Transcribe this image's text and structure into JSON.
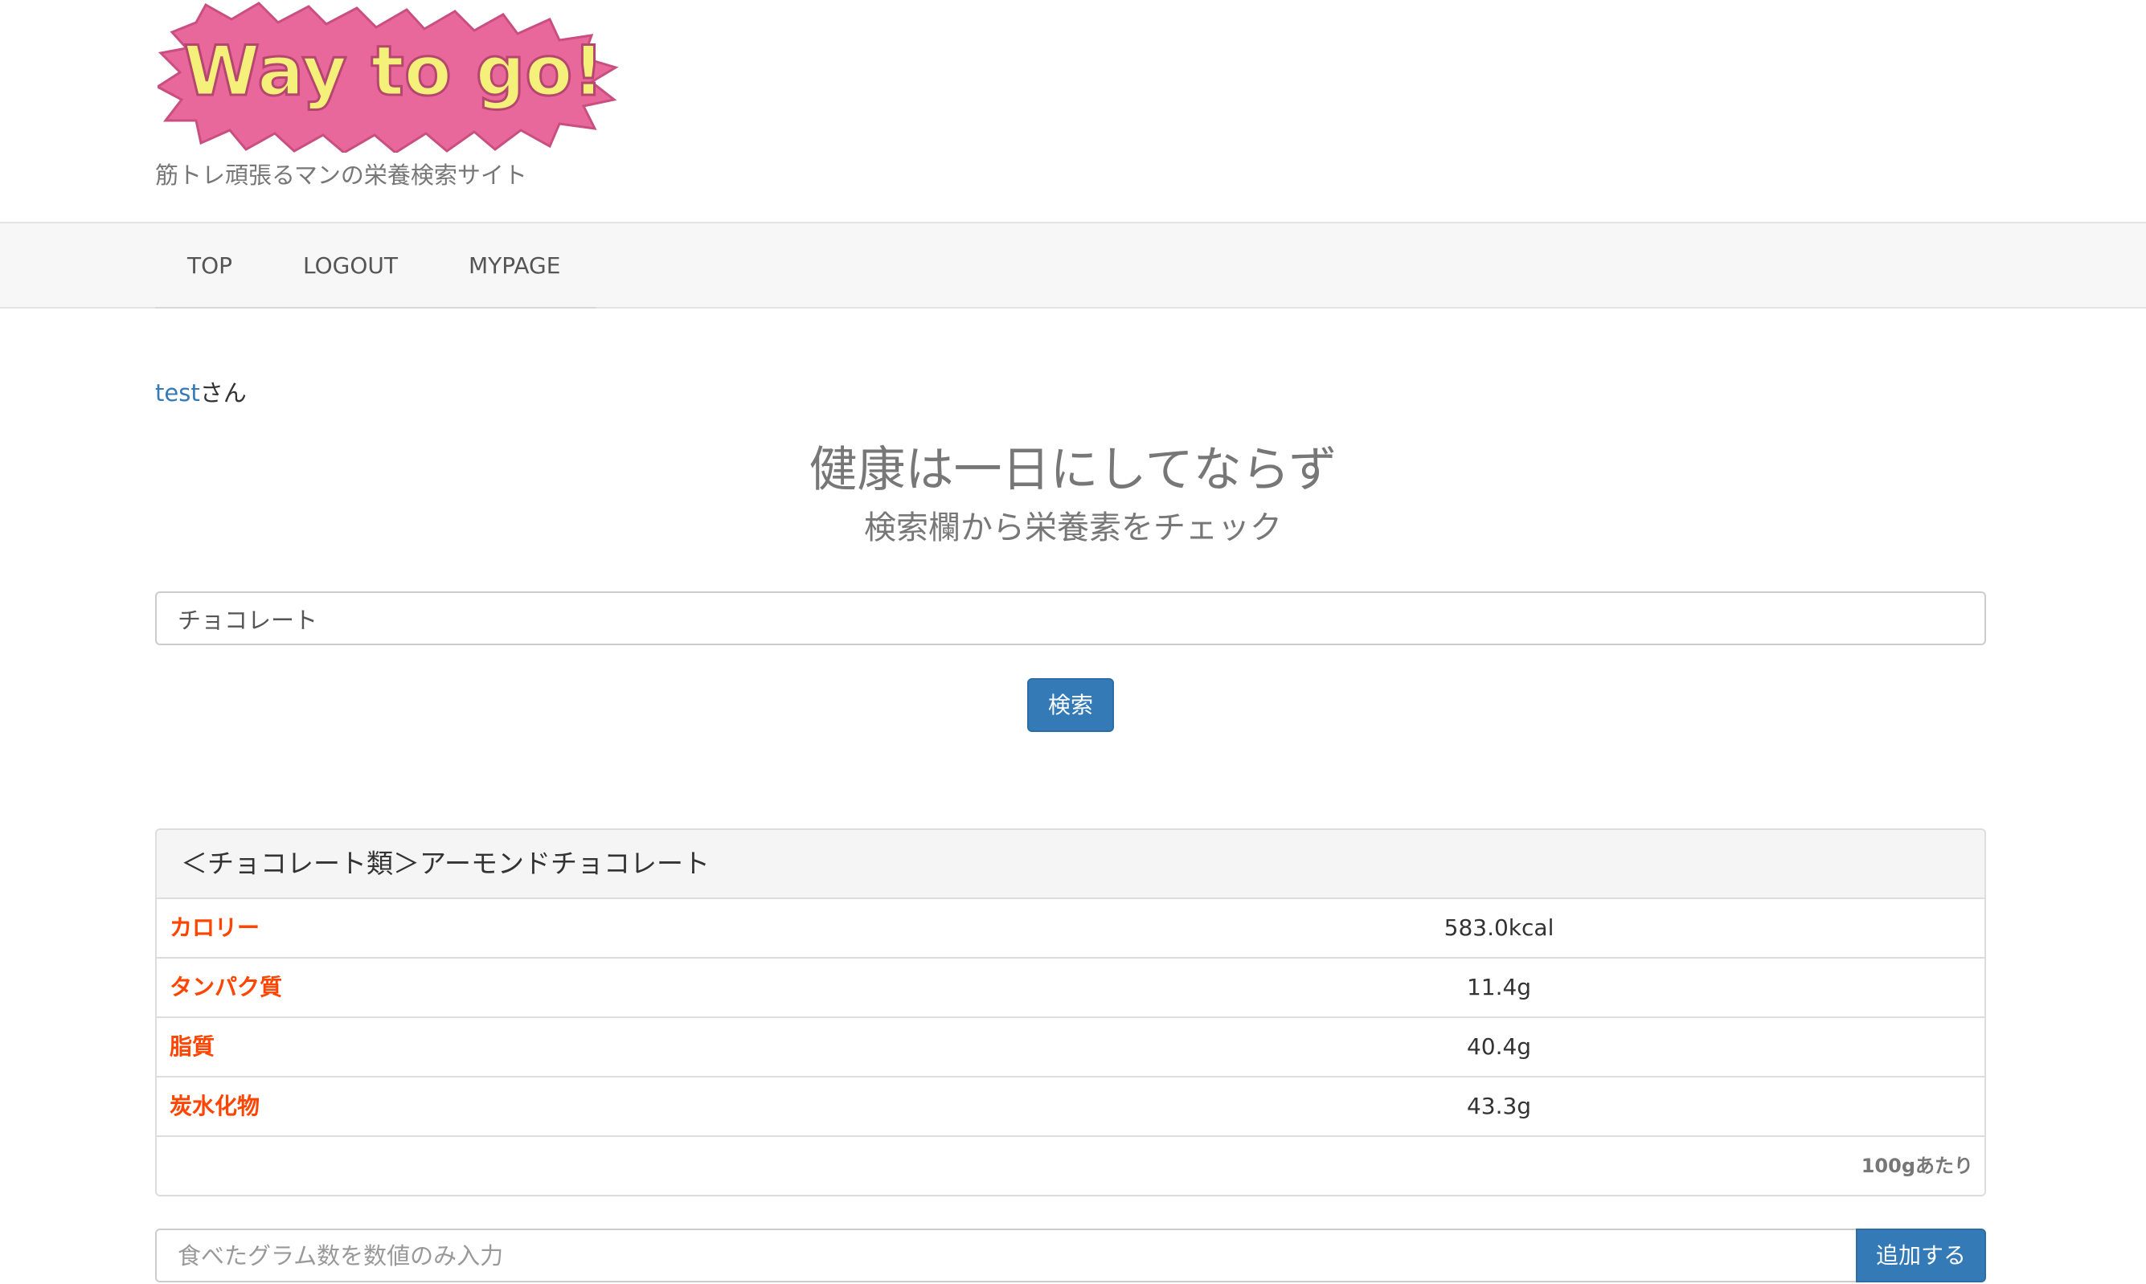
{
  "header": {
    "logo_text": "Way to go!",
    "tagline": "筋トレ頑張るマンの栄養検索サイト"
  },
  "nav": {
    "items": [
      {
        "label": "TOP"
      },
      {
        "label": "LOGOUT"
      },
      {
        "label": "MYPAGE"
      }
    ]
  },
  "greeting": {
    "username": "test",
    "suffix": "さん"
  },
  "hero": {
    "title": "健康は一日にしてならず",
    "subtitle": "検索欄から栄養素をチェック"
  },
  "search": {
    "value": "チョコレート",
    "button_label": "検索"
  },
  "result": {
    "heading": "＜チョコレート類＞アーモンドチョコレート",
    "rows": [
      {
        "label": "カロリー",
        "value": "583.0kcal"
      },
      {
        "label": "タンパク質",
        "value": "11.4g"
      },
      {
        "label": "脂質",
        "value": "40.4g"
      },
      {
        "label": "炭水化物",
        "value": "43.3g"
      }
    ],
    "per_note": "100gあたり"
  },
  "add_form": {
    "placeholder": "食べたグラム数を数値のみ入力",
    "button_label": "追加する"
  },
  "colors": {
    "primary": "#337ab7",
    "nutrient_label": "#ff4500",
    "logo_pink": "#e8689c",
    "logo_yellow": "#f5f07a"
  }
}
